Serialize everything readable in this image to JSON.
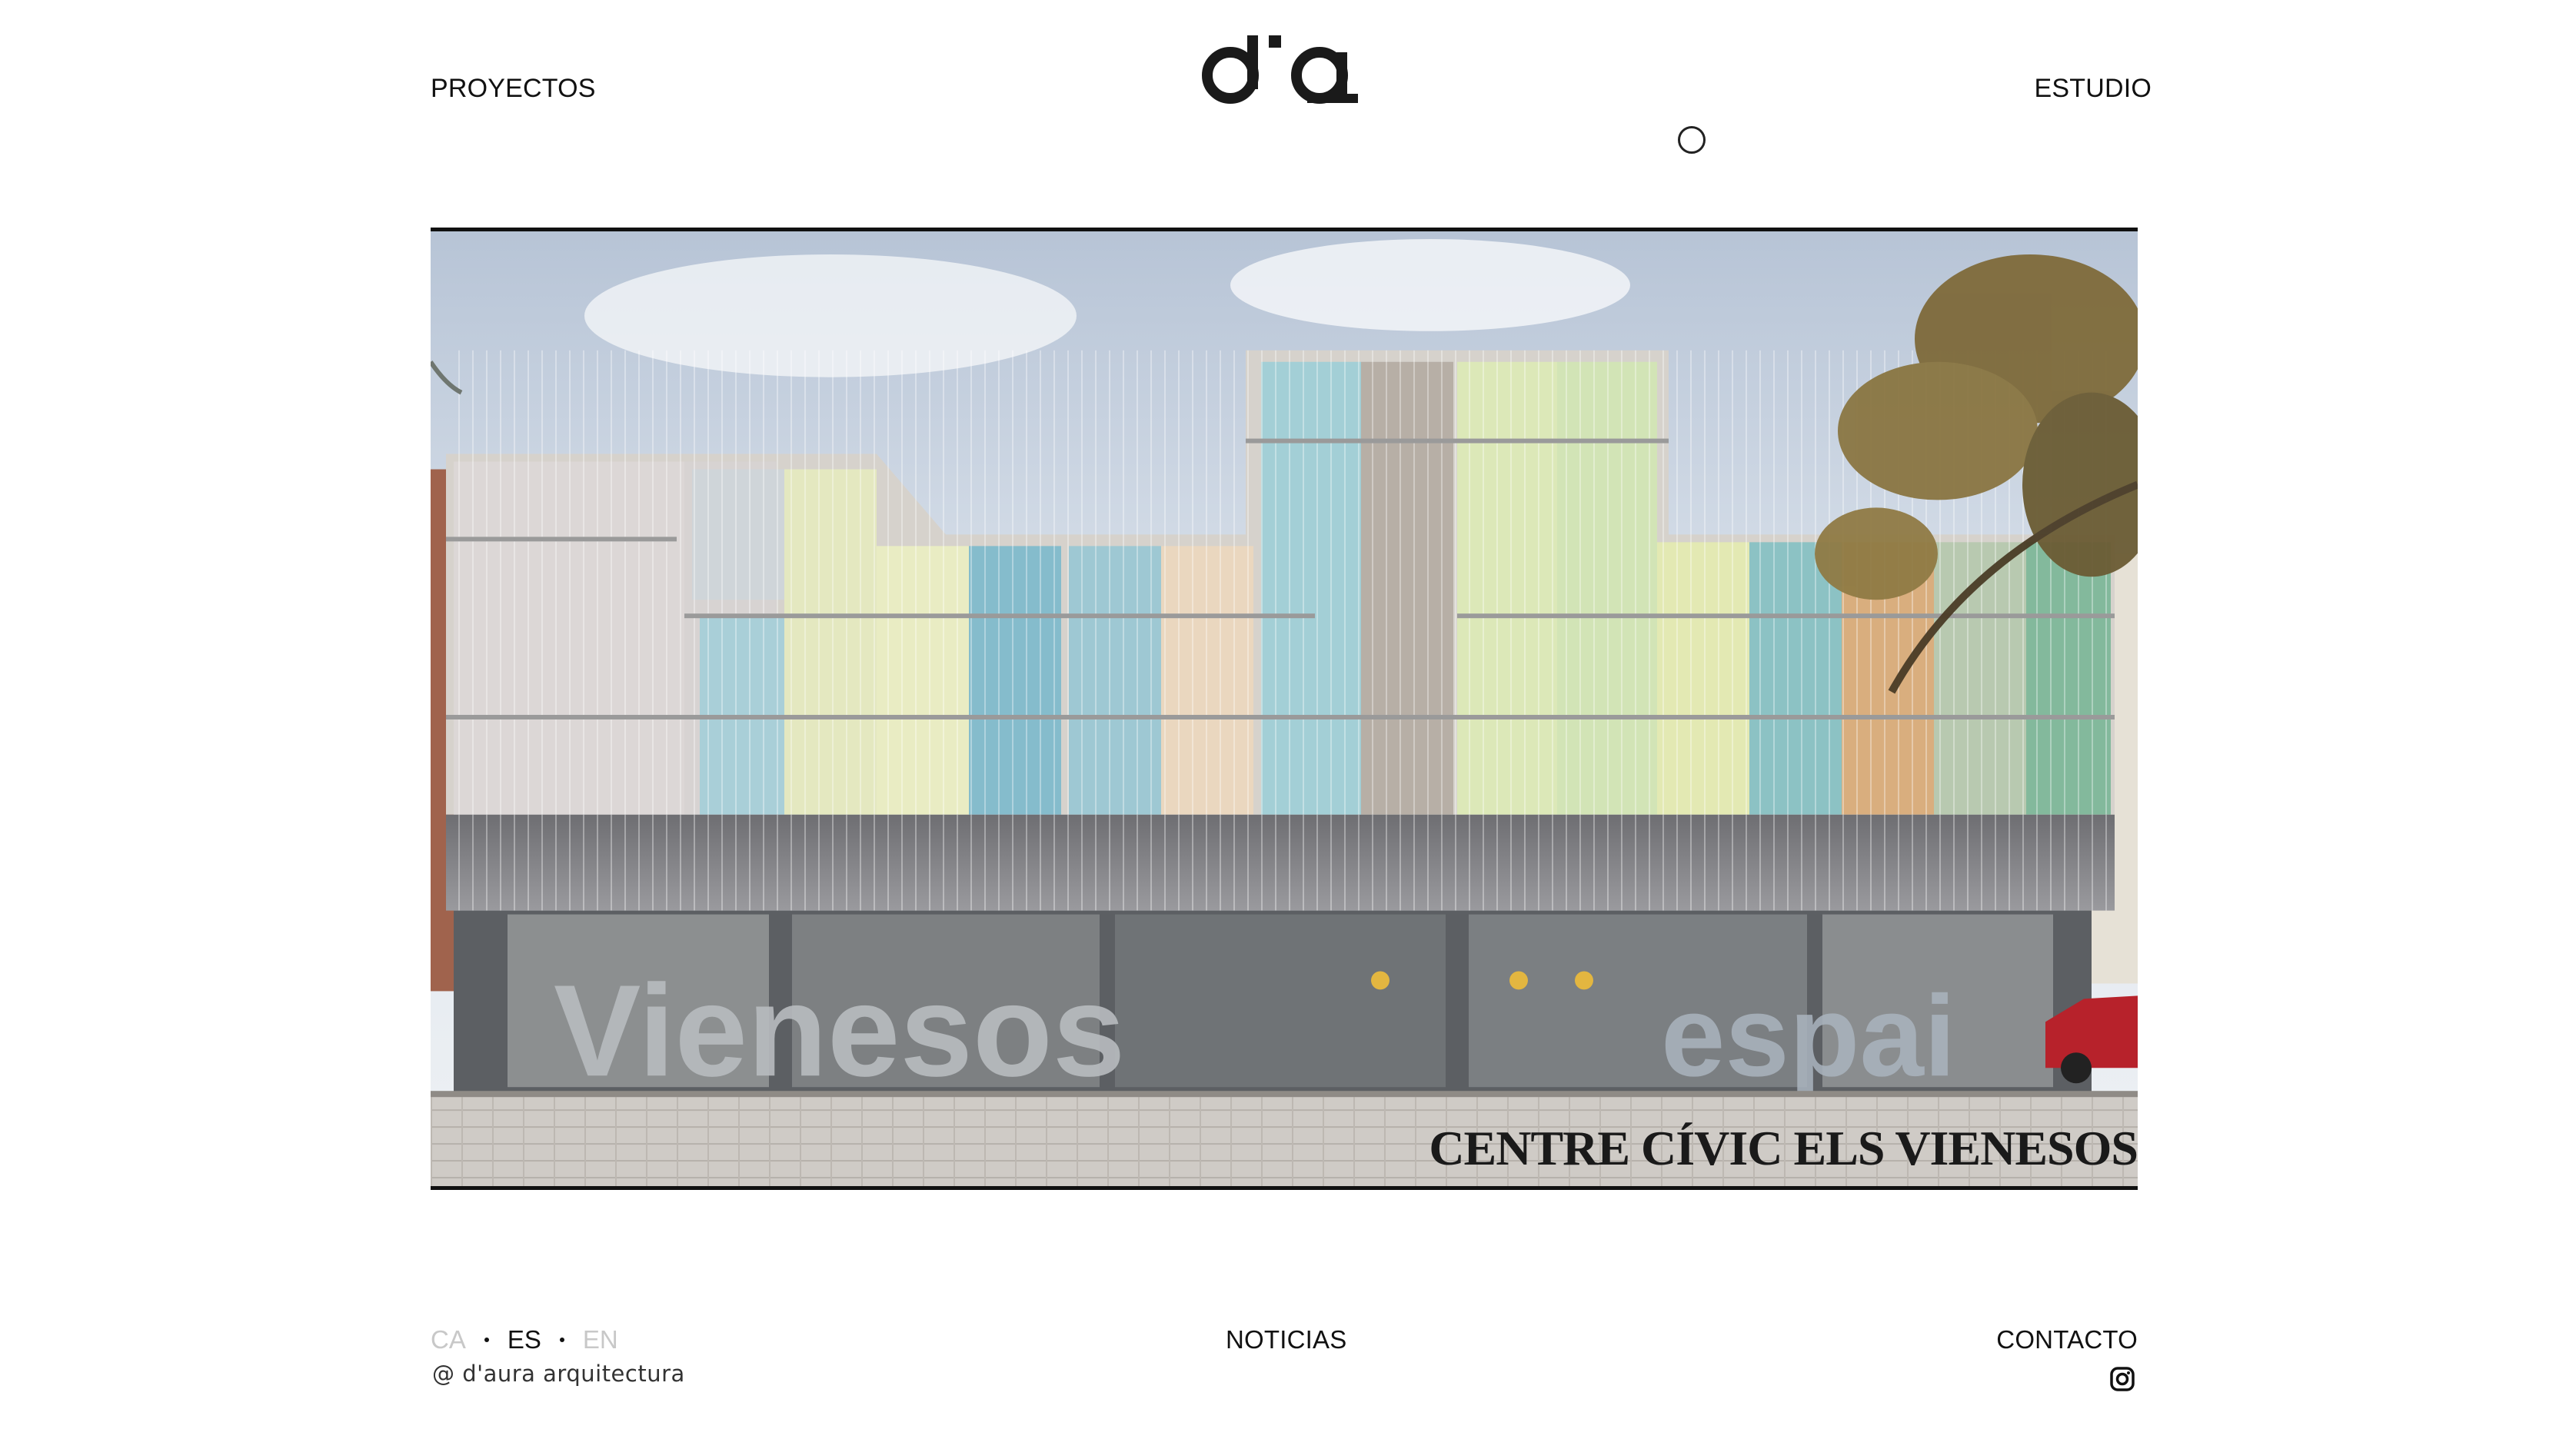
{
  "header": {
    "left_link": "PROYECTOS",
    "right_link": "ESTUDIO",
    "logo_icon": "daura-logo-icon"
  },
  "hero": {
    "caption": "CENTRE CÍVIC ELS VIENESOS",
    "facade_letters_left": "Vienesos",
    "facade_letters_right": "espai"
  },
  "footer": {
    "languages": [
      {
        "code": "CA",
        "active": false
      },
      {
        "code": "ES",
        "active": true
      },
      {
        "code": "EN",
        "active": false
      }
    ],
    "copyright": "@ d'aura arquitectura",
    "news_link": "NOTICIAS",
    "contact_link": "CONTACTO",
    "social_icon": "instagram-icon"
  },
  "colors": {
    "text": "#111111",
    "inactive_lang": "#c8c8c8",
    "background": "#ffffff"
  }
}
